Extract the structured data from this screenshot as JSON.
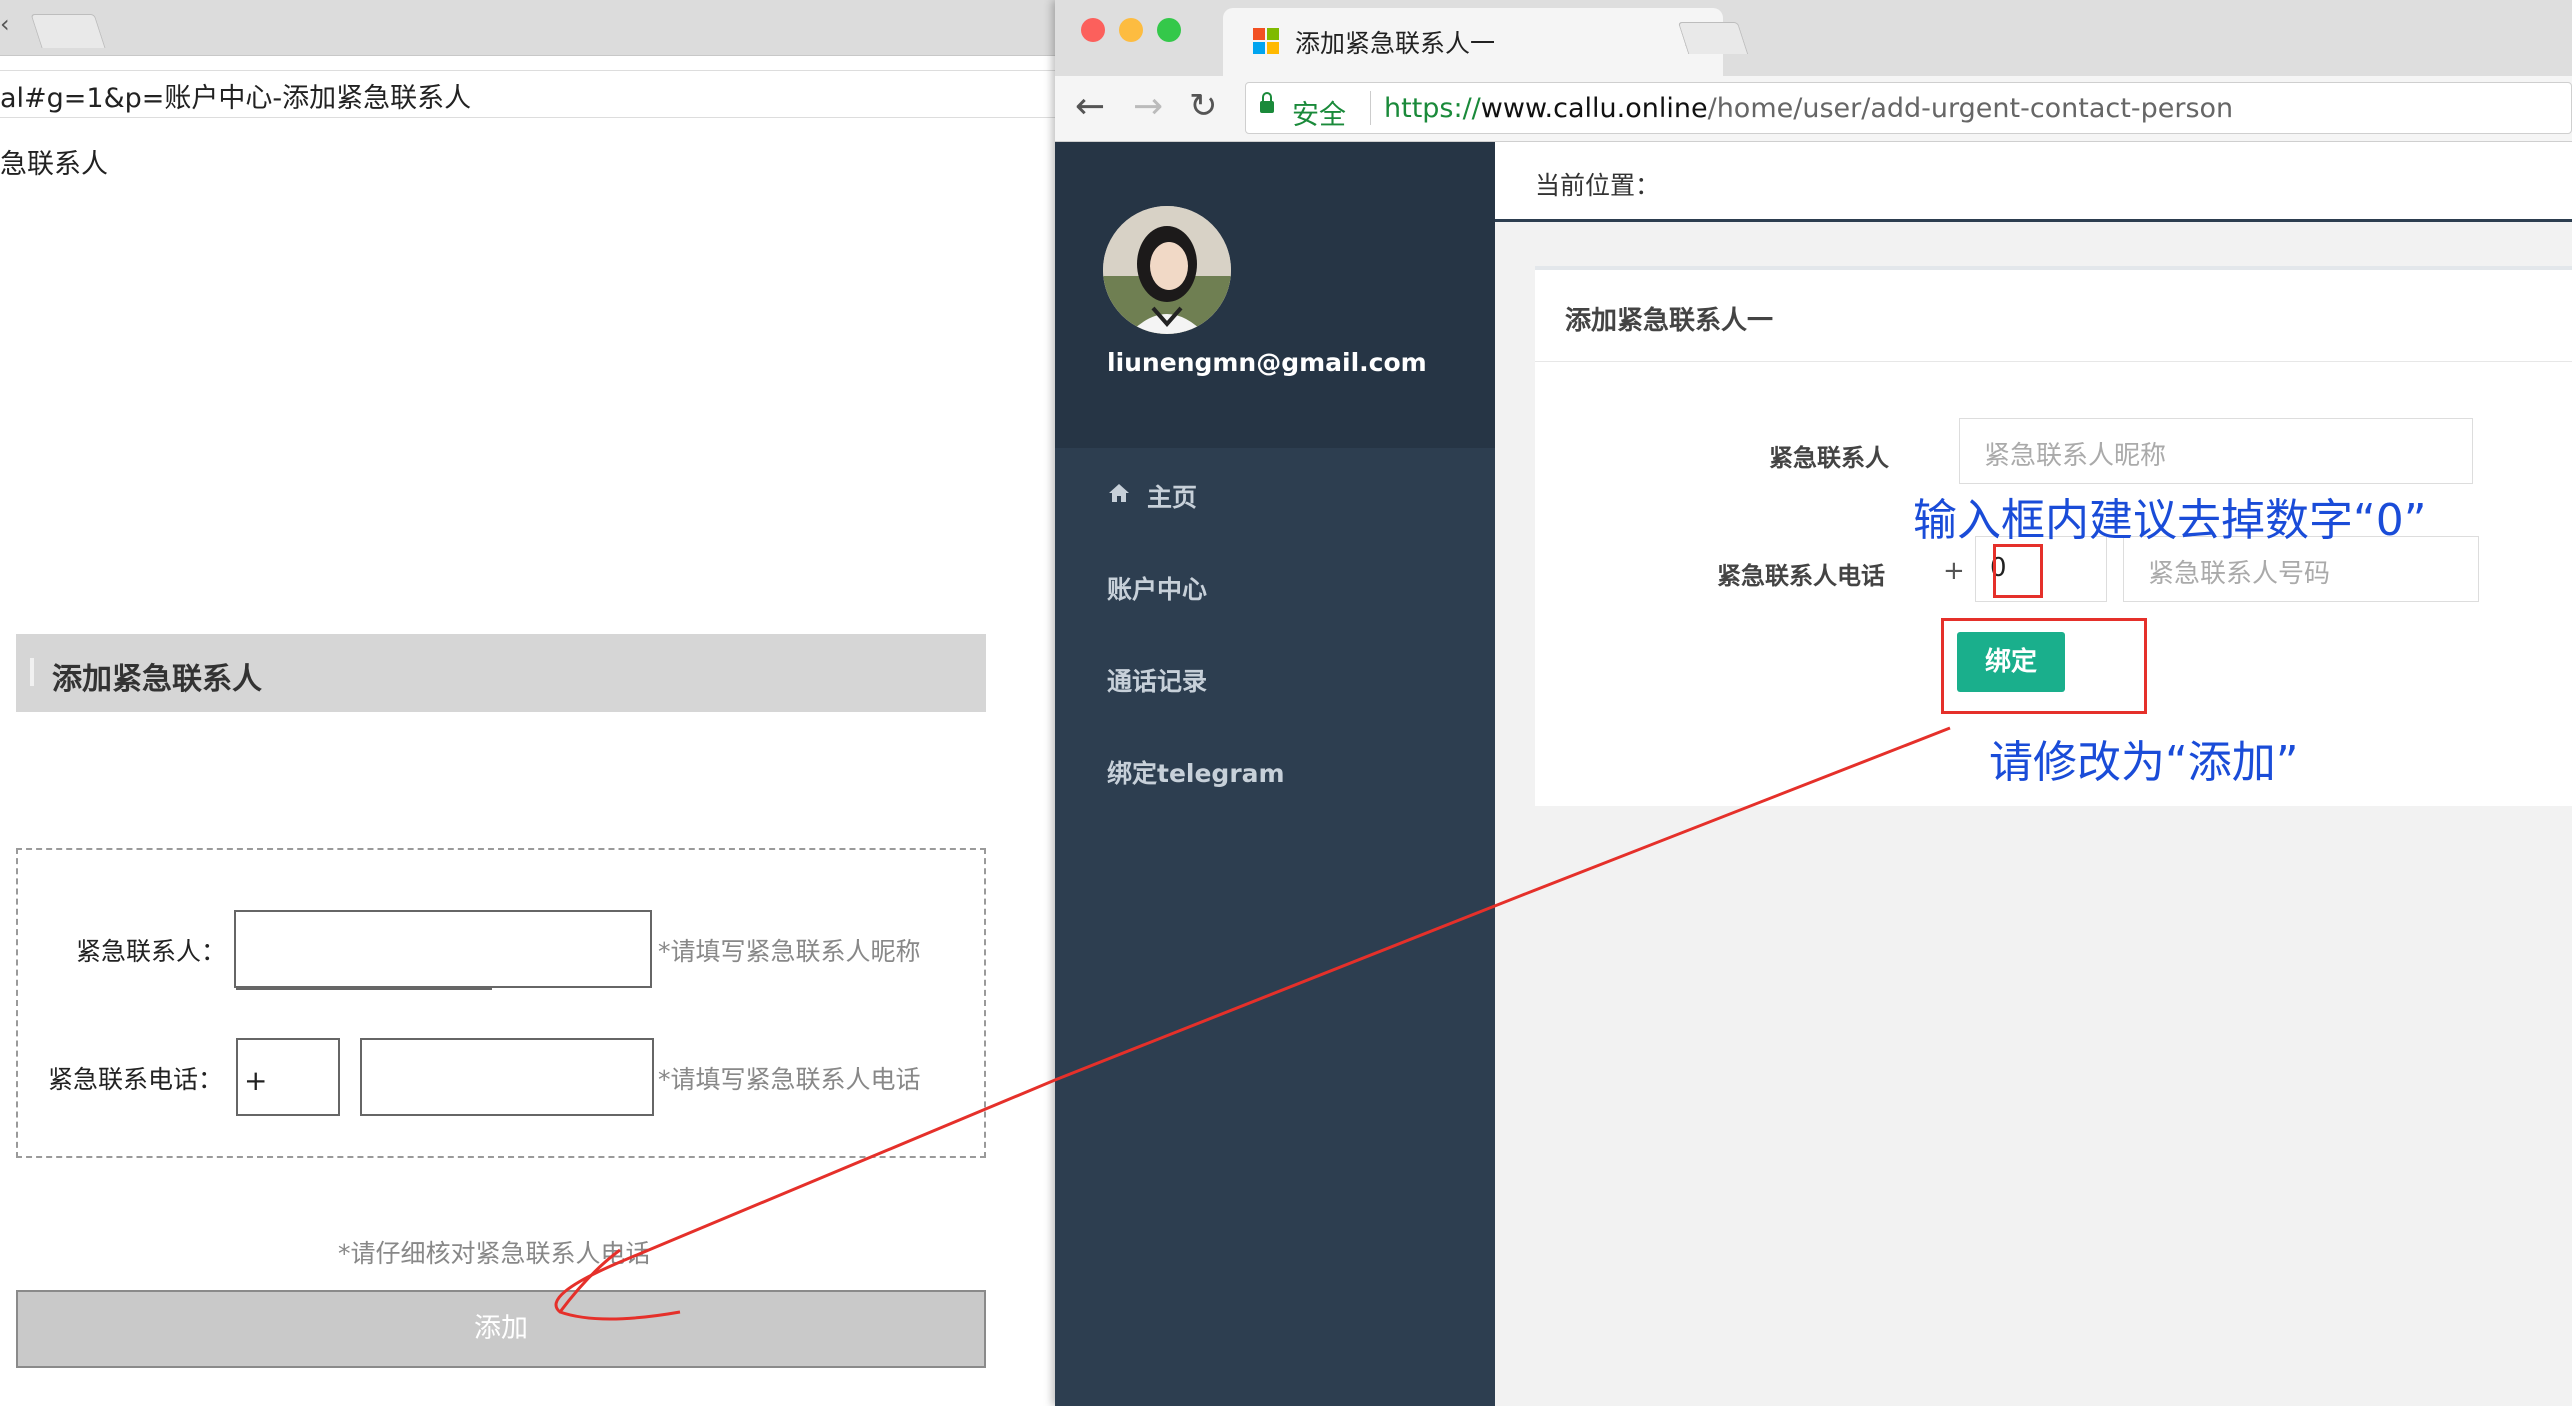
{
  "left_window": {
    "url_fragment": "al#g=1&p=账户中心-添加紧急联系人",
    "page_title_fragment": "急联系人",
    "section_title": "添加紧急联系人",
    "contact_label": "紧急联系人：",
    "contact_hint": "*请填写紧急联系人昵称",
    "phone_label": "紧急联系电话：",
    "phone_prefix": "+",
    "phone_hint": "*请填写紧急联系人电话",
    "note": "*请仔细核对紧急联系人电话",
    "add_button": "添加"
  },
  "right_window": {
    "tab_title": "添加紧急联系人一",
    "tab_close": "×",
    "address": {
      "secure_label": "安全",
      "protocol": "https://",
      "host": "www.callu.online",
      "path": "/home/user/add-urgent-contact-person"
    },
    "sidebar": {
      "email": "liunengmn@gmail.com",
      "items": [
        {
          "label": "主页",
          "icon": "home-icon"
        },
        {
          "label": "账户中心"
        },
        {
          "label": "通话记录"
        },
        {
          "label": "绑定telegram"
        }
      ]
    },
    "breadcrumb": "当前位置：",
    "panel_title": "添加紧急联系人一",
    "form": {
      "contact_label": "紧急联系人",
      "contact_placeholder": "紧急联系人昵称",
      "phone_label": "紧急联系人电话",
      "phone_prefix": "+",
      "country_code_value": "0",
      "phone_placeholder": "紧急联系人号码",
      "bind_button": "绑定"
    }
  },
  "annotations": {
    "remove_zero": "输入框内建议去掉数字“0”",
    "rename_button": "请修改为“添加”",
    "color": "#e5302a",
    "text_color": "#1a4cd8"
  }
}
